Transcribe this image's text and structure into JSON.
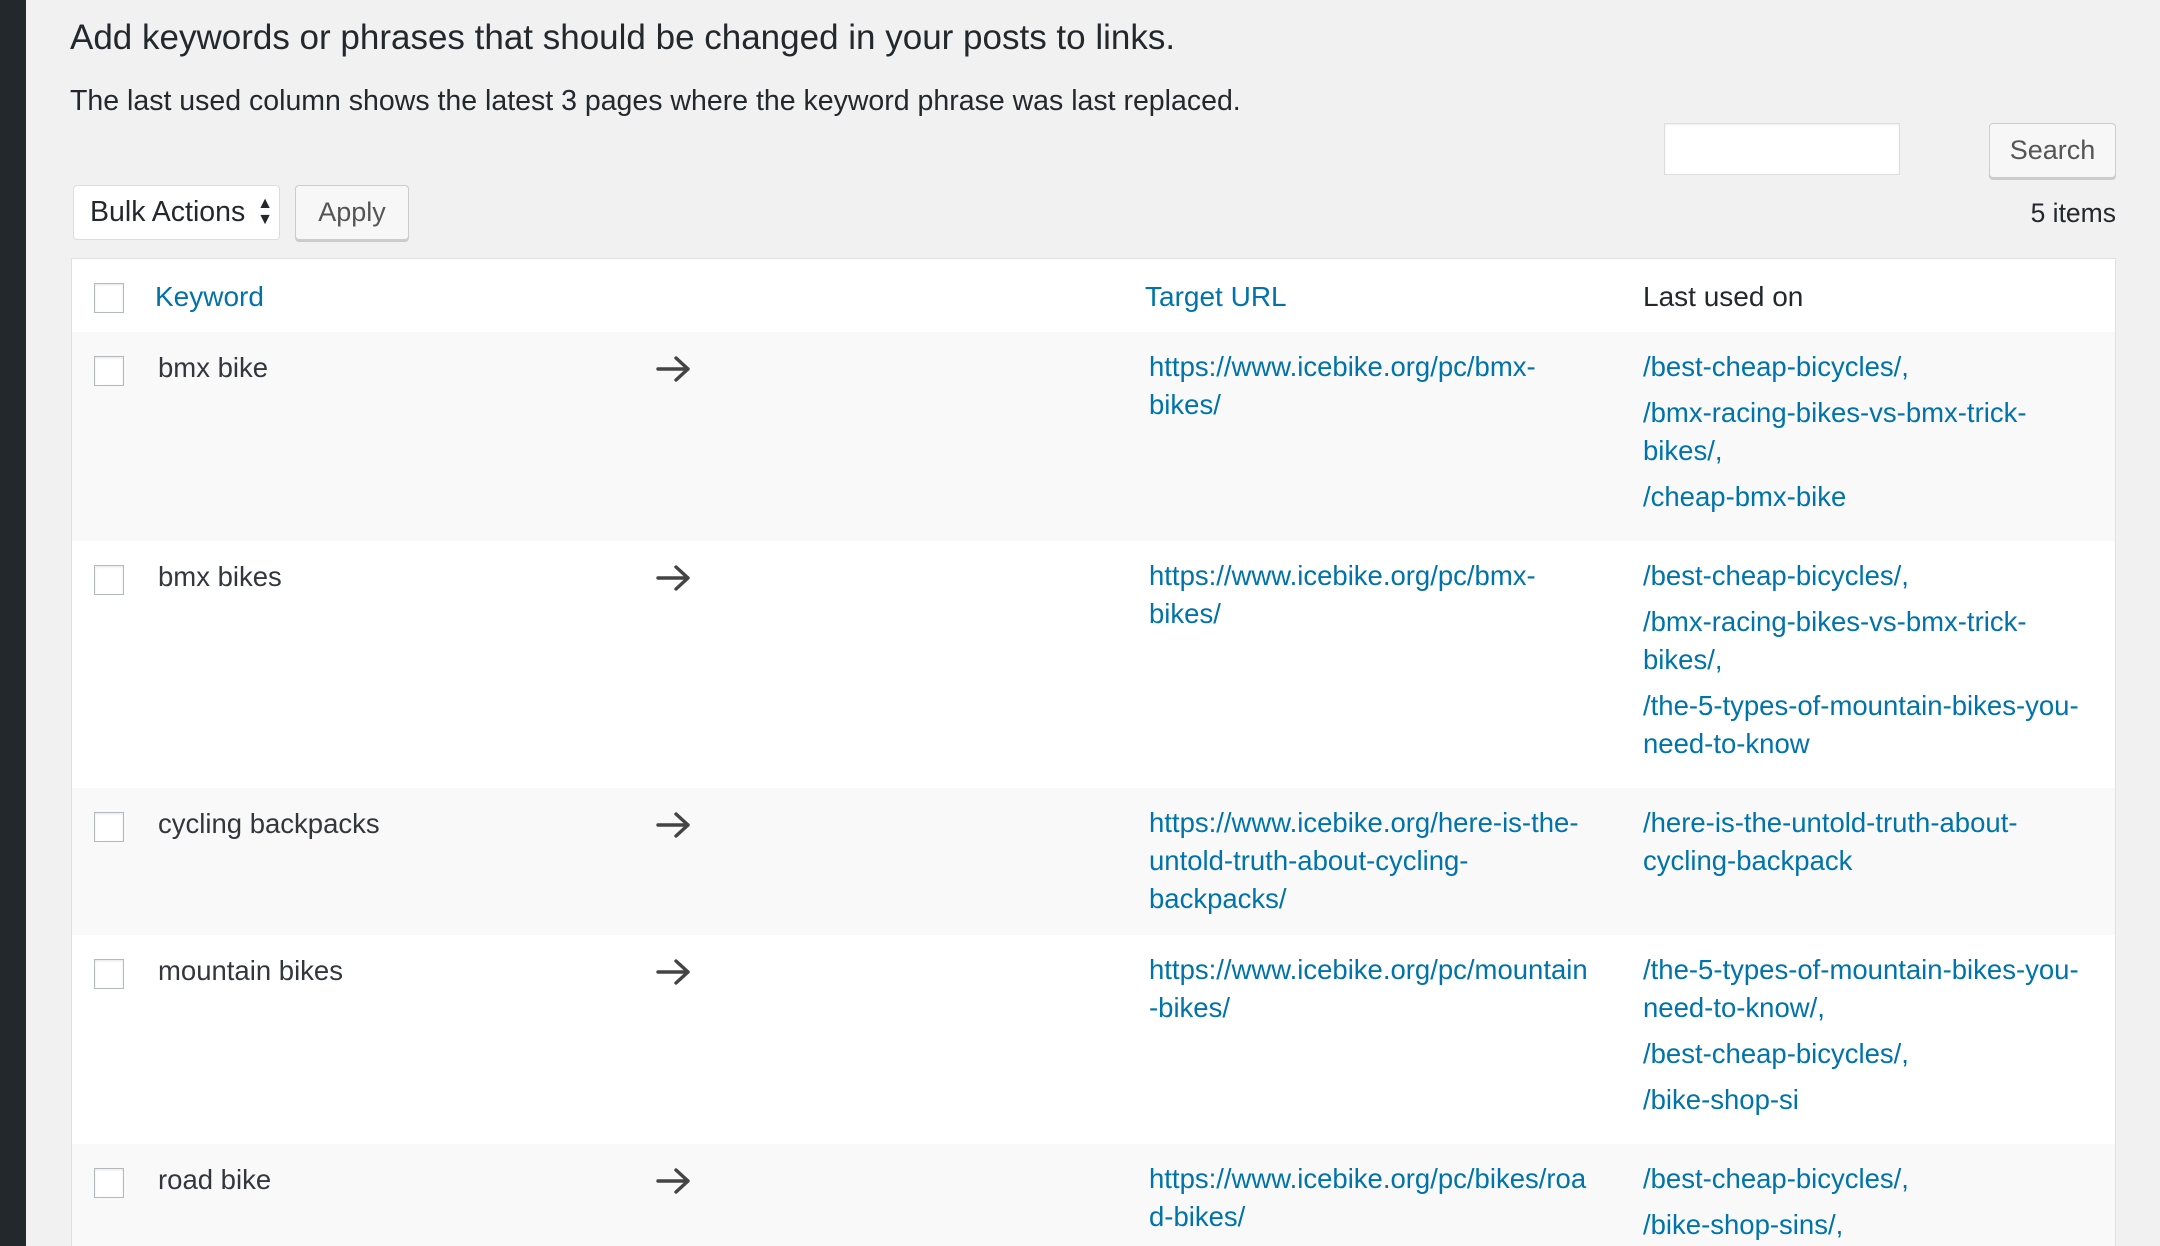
{
  "intro": {
    "line1": "Add keywords or phrases that should be changed in your posts to links.",
    "line2": "The last used column shows the latest 3 pages where the keyword phrase was last replaced."
  },
  "search": {
    "button_label": "Search",
    "value": ""
  },
  "bulk": {
    "selected": "Bulk Actions",
    "apply_label": "Apply"
  },
  "items_count": "5 items",
  "table": {
    "headers": {
      "keyword": "Keyword",
      "target_url": "Target URL",
      "last_used": "Last used on"
    },
    "arrow_icon": "right-arrow-icon",
    "rows": [
      {
        "keyword": "bmx bike",
        "url_line1": "https://www.icebike.org/pc/bmx-",
        "url_line2": "bikes/",
        "url_line3": "",
        "used": [
          "/best-cheap-bicycles/,",
          "/bmx-racing-bikes-vs-bmx-trick-bikes/,",
          "/cheap-bmx-bike"
        ]
      },
      {
        "keyword": "bmx bikes",
        "url_line1": "https://www.icebike.org/pc/bmx-",
        "url_line2": "bikes/",
        "url_line3": "",
        "used": [
          "/best-cheap-bicycles/,",
          "/bmx-racing-bikes-vs-bmx-trick-bikes/,",
          "/the-5-types-of-mountain-bikes-you-need-to-know"
        ]
      },
      {
        "keyword": "cycling backpacks",
        "url_line1": "https://www.icebike.org/here-is-the-",
        "url_line2": "untold-truth-about-cycling-",
        "url_line3": "backpacks/",
        "used": [
          "/here-is-the-untold-truth-about-cycling-backpack"
        ]
      },
      {
        "keyword": "mountain bikes",
        "url_line1": "https://www.icebike.org/pc/mountain",
        "url_line2": "-bikes/",
        "url_line3": "",
        "used": [
          "/the-5-types-of-mountain-bikes-you-need-to-know/,",
          "/best-cheap-bicycles/,",
          "/bike-shop-si"
        ]
      },
      {
        "keyword": "road bike",
        "url_line1": "https://www.icebike.org/pc/bikes/roa",
        "url_line2": "d-bikes/",
        "url_line3": "",
        "used": [
          "/best-cheap-bicycles/,",
          "/bike-shop-sins/,"
        ]
      }
    ]
  }
}
